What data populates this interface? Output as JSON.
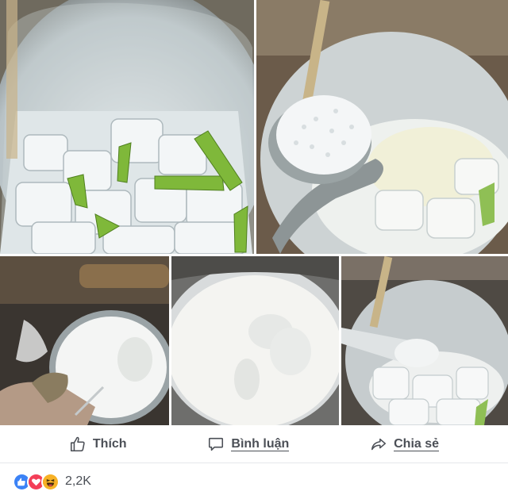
{
  "actions": {
    "like_label": "Thích",
    "comment_label": "Bình luận",
    "share_label": "Chia sẻ"
  },
  "reactions": {
    "icons": [
      "like-icon",
      "love-icon",
      "haha-icon"
    ],
    "count": "2,2K",
    "colors": {
      "like": "#3b82f6",
      "love": "#f33e58",
      "haha": "#f7b125"
    }
  }
}
